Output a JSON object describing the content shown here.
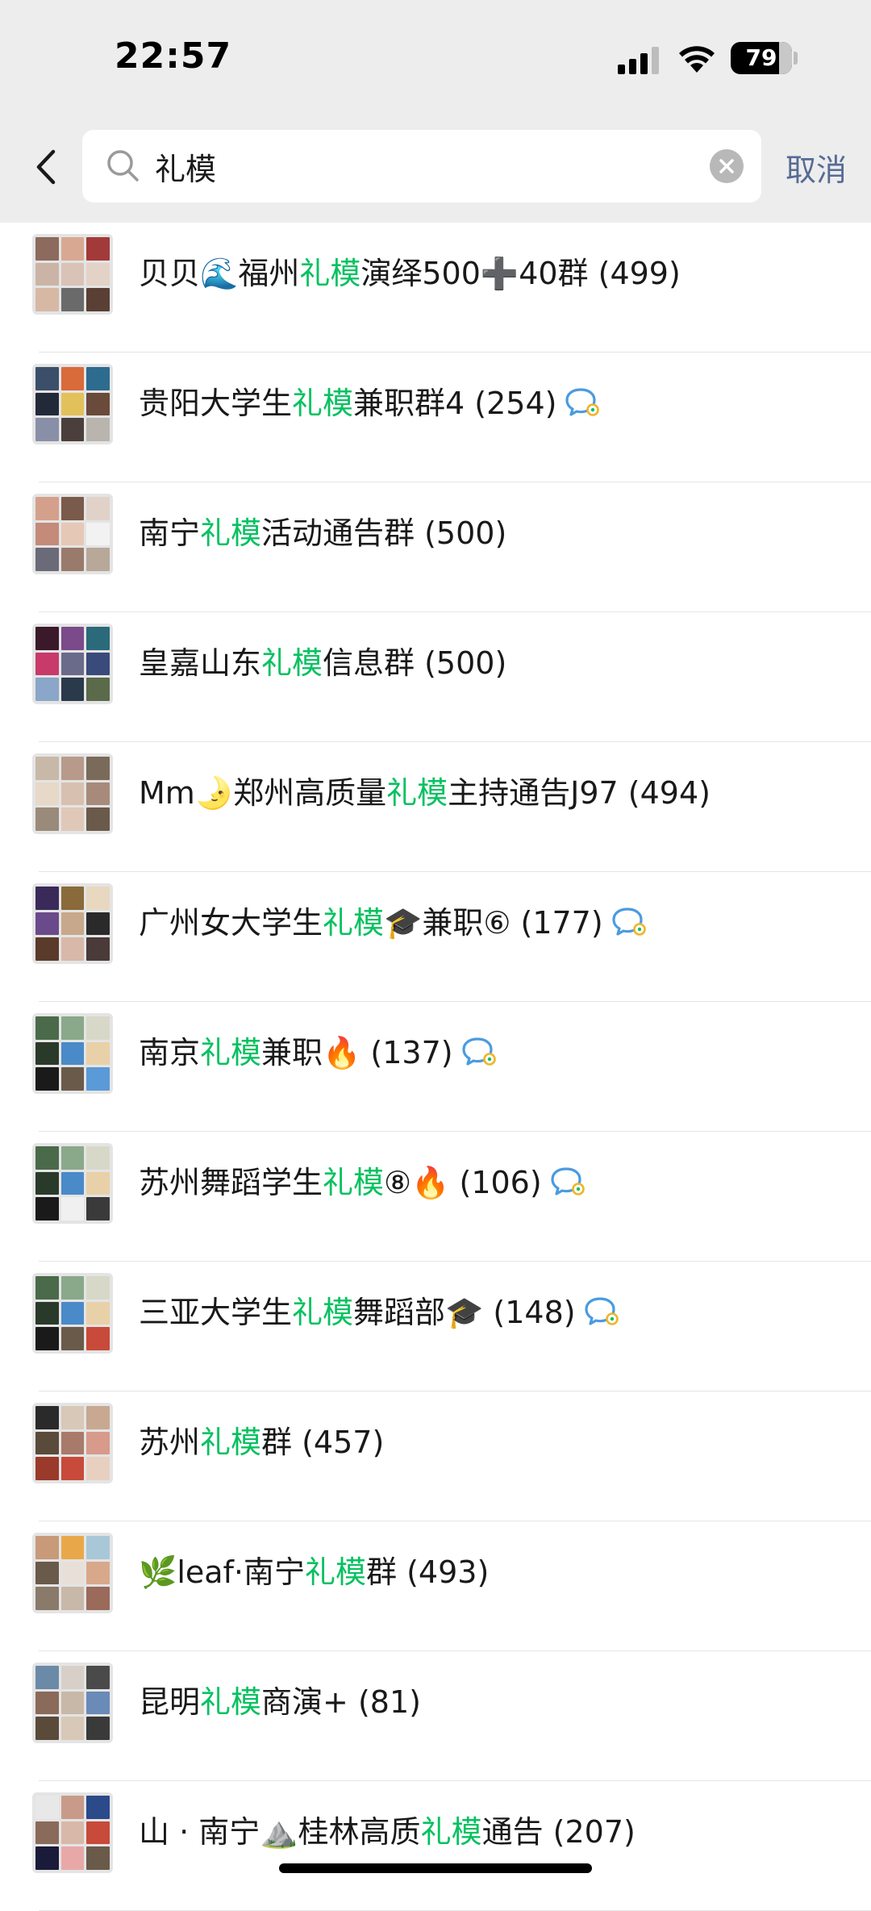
{
  "status_bar": {
    "time": "22:57",
    "battery_level": "79",
    "battery_fraction": 0.79
  },
  "search": {
    "query": "礼模",
    "cancel_label": "取消"
  },
  "highlight_color": "#07c160",
  "results": [
    {
      "parts": [
        "贝贝🌊福州",
        "礼模",
        "演绎500➕40群 (499)"
      ],
      "bubble": false,
      "avatar": [
        "#8c6a5e",
        "#d8a892",
        "#a33a3a",
        "#cbb4a6",
        "#d9c2b6",
        "#e3d2c6",
        "#d6b8a4",
        "#6a6a6a",
        "#5a3f35"
      ]
    },
    {
      "parts": [
        "贵阳大学生",
        "礼模",
        "兼职群4 (254)"
      ],
      "bubble": true,
      "avatar": [
        "#3b4f6a",
        "#d96a3a",
        "#2d6b8f",
        "#222a3a",
        "#e3c15a",
        "#6a4a3a",
        "#8a8fa8",
        "#4a3f3a",
        "#b9b4ad"
      ]
    },
    {
      "parts": [
        "南宁",
        "礼模",
        "活动通告群 (500)"
      ],
      "bubble": false,
      "avatar": [
        "#d4a08c",
        "#7a5a4a",
        "#e0d2c8",
        "#c48a7a",
        "#e6c8b6",
        "#f2f2f2",
        "#6a6a78",
        "#9a7a6a",
        "#b8a89a"
      ]
    },
    {
      "parts": [
        "皇嘉山东",
        "礼模",
        "信息群 (500)"
      ],
      "bubble": false,
      "avatar": [
        "#3a1a2a",
        "#7a4a8a",
        "#2a6a7a",
        "#c83a6a",
        "#6a6a8a",
        "#3a4a7a",
        "#8aa6c8",
        "#2a3a4a",
        "#5a6a4a"
      ]
    },
    {
      "parts": [
        "Mm🌛郑州高质量",
        "礼模",
        "主持通告J97 (494)"
      ],
      "bubble": false,
      "avatar": [
        "#c8b8a8",
        "#b89a8a",
        "#7a6a5a",
        "#e8d8c8",
        "#d8c0b0",
        "#a88a7a",
        "#9a8a7a",
        "#e0c8b8",
        "#6a5a4a"
      ]
    },
    {
      "parts": [
        "广州女大学生",
        "礼模",
        "🎓兼职⑥ (177)"
      ],
      "bubble": true,
      "avatar": [
        "#3a2a5a",
        "#8a6a3a",
        "#e8d8c0",
        "#6a4a8a",
        "#c8a88a",
        "#2a2a2a",
        "#5a3a2a",
        "#d8b8a8",
        "#4a3a3a"
      ]
    },
    {
      "parts": [
        "南京",
        "礼模",
        "兼职🔥 (137)"
      ],
      "bubble": true,
      "avatar": [
        "#4a6a4a",
        "#8aa88a",
        "#d8d8c8",
        "#2a3a2a",
        "#4a8ac8",
        "#e8d0a8",
        "#1a1a1a",
        "#6a5a4a",
        "#5a9ad8"
      ]
    },
    {
      "parts": [
        "苏州舞蹈学生",
        "礼模",
        "⑧🔥 (106)"
      ],
      "bubble": true,
      "avatar": [
        "#4a6a4a",
        "#8aa88a",
        "#d8d8c8",
        "#2a3a2a",
        "#4a8ac8",
        "#e8d0a8",
        "#1a1a1a",
        "#f0f0f0",
        "#3a3a3a"
      ]
    },
    {
      "parts": [
        "三亚大学生",
        "礼模",
        "舞蹈部🎓 (148)"
      ],
      "bubble": true,
      "avatar": [
        "#4a6a4a",
        "#8aa88a",
        "#d8d8c8",
        "#2a3a2a",
        "#4a8ac8",
        "#e8d0a8",
        "#1a1a1a",
        "#6a5a4a",
        "#c84a3a"
      ]
    },
    {
      "parts": [
        "苏州",
        "礼模",
        "群 (457)"
      ],
      "bubble": false,
      "avatar": [
        "#2a2a2a",
        "#d8c8b8",
        "#c8a890",
        "#5a4a3a",
        "#a87a6a",
        "#d89a8a",
        "#9a3a2a",
        "#c84a3a",
        "#e8d0c0"
      ]
    },
    {
      "parts": [
        "🌿leaf·南宁",
        "礼模",
        "群 (493)"
      ],
      "bubble": false,
      "avatar": [
        "#c89a7a",
        "#e8a84a",
        "#a8c8d8",
        "#6a5a4a",
        "#e8e0d8",
        "#d8a88a",
        "#8a7a6a",
        "#c8b8a8",
        "#9a6a5a"
      ]
    },
    {
      "parts": [
        "昆明",
        "礼模",
        "商演+ (81)"
      ],
      "bubble": false,
      "avatar": [
        "#6a8aa8",
        "#d8d0c8",
        "#4a4a4a",
        "#8a6a5a",
        "#c8b8a8",
        "#6a8ab8",
        "#5a4a3a",
        "#d8c8b8",
        "#3a3a3a"
      ]
    },
    {
      "parts": [
        "山 · 南宁⛰️桂林高质",
        "礼模",
        "通告 (207)"
      ],
      "bubble": false,
      "avatar": [
        "#e8e8e8",
        "#c89a8a",
        "#2a4a8a",
        "#8a6a5a",
        "#d8b8a8",
        "#c84a3a",
        "#1a1a3a",
        "#e8a8a8",
        "#6a5a4a"
      ]
    }
  ]
}
